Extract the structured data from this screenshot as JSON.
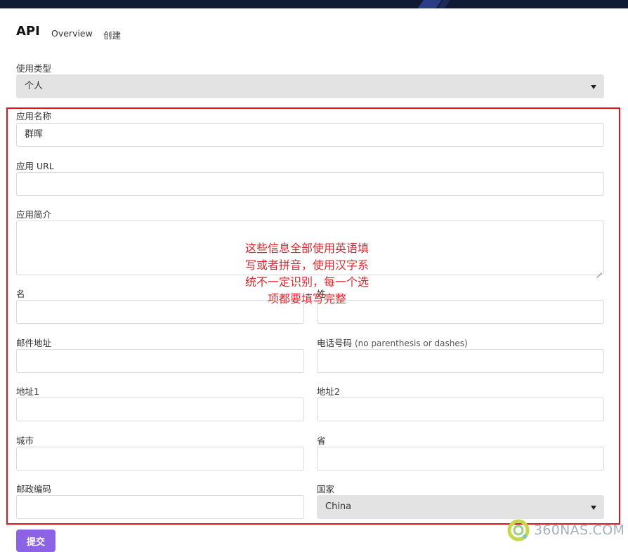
{
  "header": {
    "title": "API",
    "tabs": [
      "Overview",
      "创建"
    ]
  },
  "form": {
    "usage_type": {
      "label": "使用类型",
      "value": "个人"
    },
    "app_name": {
      "label": "应用名称",
      "value": "群晖"
    },
    "app_url": {
      "label": "应用 URL",
      "value": ""
    },
    "app_desc": {
      "label": "应用简介",
      "value": ""
    },
    "first_name": {
      "label": "名",
      "value": ""
    },
    "last_name": {
      "label": "姓",
      "value": ""
    },
    "email": {
      "label": "邮件地址",
      "value": ""
    },
    "phone": {
      "label": "电话号码",
      "hint": "(no parenthesis or dashes)",
      "value": ""
    },
    "address1": {
      "label": "地址1",
      "value": ""
    },
    "address2": {
      "label": "地址2",
      "value": ""
    },
    "city": {
      "label": "城市",
      "value": ""
    },
    "province": {
      "label": "省",
      "value": ""
    },
    "postal_code": {
      "label": "邮政编码",
      "value": ""
    },
    "country": {
      "label": "国家",
      "value": "China"
    },
    "submit_label": "提交"
  },
  "annotation": {
    "lines": [
      "这些信息全部使用英语填",
      "写或者拼音，使用汉字系",
      "统不一定识别，每一个选",
      "项都要填写完整"
    ],
    "color": "#e0262b"
  },
  "watermark": {
    "text": "360NAS.COM"
  },
  "colors": {
    "topbar": "#0f1b33",
    "accent": "#8d63e6",
    "annotation_frame": "#e2161c"
  }
}
